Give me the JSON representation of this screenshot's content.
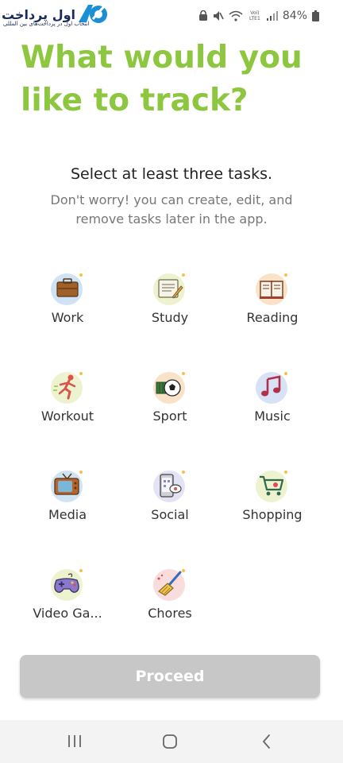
{
  "status_bar": {
    "watermark_text": "اول پرداخت",
    "watermark_sub": "انتخاب اول در پرداخت‌های بین المللی",
    "network_label": "Voi) LTE1",
    "battery": "84%"
  },
  "header": {
    "title": "What would you like to track?",
    "subtitle": "Select at least three tasks.",
    "description": "Don't worry! you can create, edit, and remove tasks later in the app."
  },
  "tasks": [
    {
      "label": "Work",
      "icon": "briefcase-icon",
      "color": "#cfe3f5"
    },
    {
      "label": "Study",
      "icon": "notebook-icon",
      "color": "#eef3cf"
    },
    {
      "label": "Reading",
      "icon": "book-icon",
      "color": "#f9e2c8"
    },
    {
      "label": "Workout",
      "icon": "runner-icon",
      "color": "#eef3cf"
    },
    {
      "label": "Sport",
      "icon": "soccer-icon",
      "color": "#f9e2c8"
    },
    {
      "label": "Music",
      "icon": "music-note-icon",
      "color": "#d8e2f5"
    },
    {
      "label": "Media",
      "icon": "tv-icon",
      "color": "#cfe3f5"
    },
    {
      "label": "Social",
      "icon": "phone-chat-icon",
      "color": "#e3e3f5"
    },
    {
      "label": "Shopping",
      "icon": "cart-icon",
      "color": "#eef3cf"
    },
    {
      "label": "Video Ga...",
      "icon": "gamepad-icon",
      "color": "#eef3cf"
    },
    {
      "label": "Chores",
      "icon": "broom-icon",
      "color": "#f9dcdc"
    }
  ],
  "proceed": {
    "label": "Proceed"
  },
  "colors": {
    "accent": "#8dc63f",
    "button_disabled": "#c7c7c7"
  }
}
